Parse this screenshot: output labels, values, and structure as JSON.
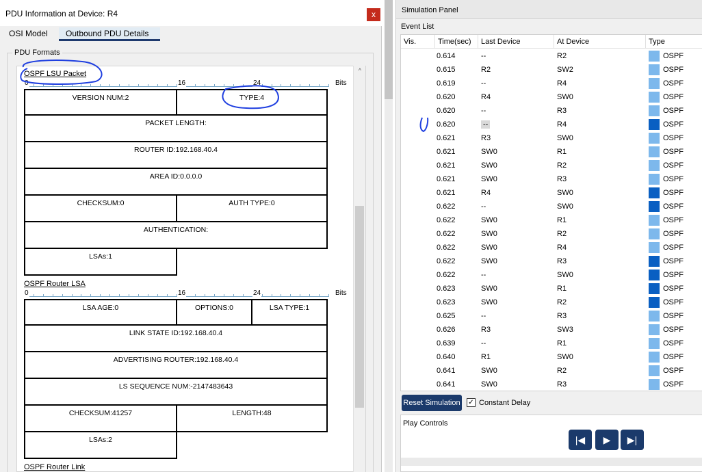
{
  "pdu_window": {
    "title": "PDU Information at Device: R4",
    "close_glyph": "x",
    "tabs": [
      "OSI Model",
      "Outbound PDU Details"
    ],
    "group_label": "PDU Formats",
    "scroll_up_glyph": "^",
    "bits_label": "Bits",
    "ruler_numbers": [
      "0",
      "16",
      "24"
    ],
    "packets": [
      {
        "title": "OSPF LSU Packet",
        "fields": [
          "VERSION NUM:2",
          "TYPE:4",
          "PACKET LENGTH:",
          "ROUTER ID:192.168.40.4",
          "AREA ID:0.0.0.0",
          "CHECKSUM:0",
          "AUTH TYPE:0",
          "AUTHENTICATION:",
          "LSAs:1"
        ]
      },
      {
        "title": "OSPF Router LSA",
        "fields": [
          "LSA AGE:0",
          "OPTIONS:0",
          "LSA TYPE:1",
          "LINK STATE ID:192.168.40.4",
          "ADVERTISING ROUTER:192.168.40.4",
          "LS SEQUENCE NUM:-2147483643",
          "CHECKSUM:41257",
          "LENGTH:48",
          "LSAs:2"
        ]
      },
      {
        "title": "OSPF Router Link"
      }
    ]
  },
  "sim_panel": {
    "title": "Simulation Panel",
    "event_list_label": "Event List",
    "columns": [
      "Vis.",
      "Time(sec)",
      "Last Device",
      "At Device",
      "Type"
    ],
    "colors": {
      "light": "#7db8ec",
      "dark": "#0a5fc2"
    },
    "events": [
      {
        "time": "0.614",
        "last": "--",
        "at": "R2",
        "type": "OSPF",
        "color": "light"
      },
      {
        "time": "0.615",
        "last": "R2",
        "at": "SW2",
        "type": "OSPF",
        "color": "light"
      },
      {
        "time": "0.619",
        "last": "--",
        "at": "R4",
        "type": "OSPF",
        "color": "light"
      },
      {
        "time": "0.620",
        "last": "R4",
        "at": "SW0",
        "type": "OSPF",
        "color": "light"
      },
      {
        "time": "0.620",
        "last": "--",
        "at": "R3",
        "type": "OSPF",
        "color": "light"
      },
      {
        "time": "0.620",
        "last": "--",
        "at": "R4",
        "type": "OSPF",
        "color": "dark"
      },
      {
        "time": "0.621",
        "last": "R3",
        "at": "SW0",
        "type": "OSPF",
        "color": "light"
      },
      {
        "time": "0.621",
        "last": "SW0",
        "at": "R1",
        "type": "OSPF",
        "color": "light"
      },
      {
        "time": "0.621",
        "last": "SW0",
        "at": "R2",
        "type": "OSPF",
        "color": "light"
      },
      {
        "time": "0.621",
        "last": "SW0",
        "at": "R3",
        "type": "OSPF",
        "color": "light"
      },
      {
        "time": "0.621",
        "last": "R4",
        "at": "SW0",
        "type": "OSPF",
        "color": "dark"
      },
      {
        "time": "0.622",
        "last": "--",
        "at": "SW0",
        "type": "OSPF",
        "color": "dark"
      },
      {
        "time": "0.622",
        "last": "SW0",
        "at": "R1",
        "type": "OSPF",
        "color": "light"
      },
      {
        "time": "0.622",
        "last": "SW0",
        "at": "R2",
        "type": "OSPF",
        "color": "light"
      },
      {
        "time": "0.622",
        "last": "SW0",
        "at": "R4",
        "type": "OSPF",
        "color": "light"
      },
      {
        "time": "0.622",
        "last": "SW0",
        "at": "R3",
        "type": "OSPF",
        "color": "dark"
      },
      {
        "time": "0.622",
        "last": "--",
        "at": "SW0",
        "type": "OSPF",
        "color": "dark"
      },
      {
        "time": "0.623",
        "last": "SW0",
        "at": "R1",
        "type": "OSPF",
        "color": "dark"
      },
      {
        "time": "0.623",
        "last": "SW0",
        "at": "R2",
        "type": "OSPF",
        "color": "dark"
      },
      {
        "time": "0.625",
        "last": "--",
        "at": "R3",
        "type": "OSPF",
        "color": "light"
      },
      {
        "time": "0.626",
        "last": "R3",
        "at": "SW3",
        "type": "OSPF",
        "color": "light"
      },
      {
        "time": "0.639",
        "last": "--",
        "at": "R1",
        "type": "OSPF",
        "color": "light"
      },
      {
        "time": "0.640",
        "last": "R1",
        "at": "SW0",
        "type": "OSPF",
        "color": "light"
      },
      {
        "time": "0.641",
        "last": "SW0",
        "at": "R2",
        "type": "OSPF",
        "color": "light"
      },
      {
        "time": "0.641",
        "last": "SW0",
        "at": "R3",
        "type": "OSPF",
        "color": "light"
      }
    ],
    "reset_button": "Reset Simulation",
    "constant_delay": {
      "label": "Constant Delay",
      "checked": true
    },
    "play_controls_label": "Play Controls",
    "play_buttons": [
      "back-icon",
      "play-icon",
      "forward-icon"
    ],
    "play_glyphs": [
      "|◀",
      "▶",
      "▶|"
    ]
  }
}
